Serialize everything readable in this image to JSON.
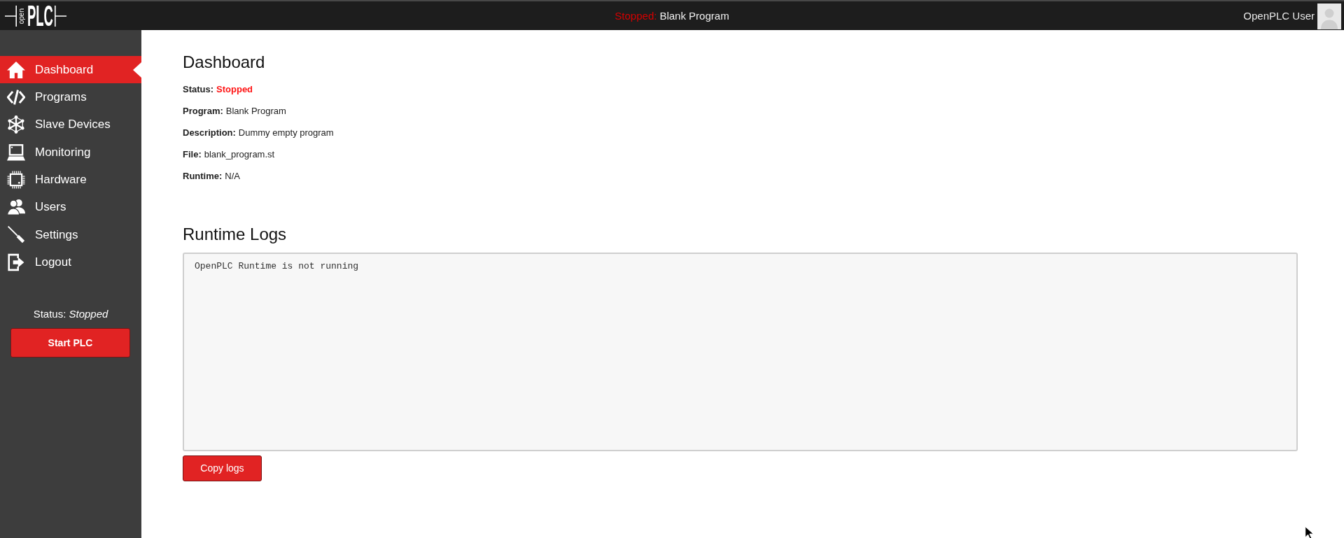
{
  "top_bar": {
    "logo": {
      "small_text": "open",
      "large_text": "PLC"
    },
    "run_state": "Stopped:",
    "program_name": "Blank Program",
    "user_name": "OpenPLC User"
  },
  "sidebar": {
    "items": [
      {
        "label": "Dashboard",
        "kind": "home",
        "selected": true
      },
      {
        "label": "Programs",
        "kind": "code",
        "selected": false
      },
      {
        "label": "Slave Devices",
        "kind": "nodes",
        "selected": false
      },
      {
        "label": "Monitoring",
        "kind": "laptop",
        "selected": false
      },
      {
        "label": "Hardware",
        "kind": "chip",
        "selected": false
      },
      {
        "label": "Users",
        "kind": "users",
        "selected": false
      },
      {
        "label": "Settings",
        "kind": "screwdriver",
        "selected": false
      },
      {
        "label": "Logout",
        "kind": "exit",
        "selected": false
      }
    ],
    "status": "Status: *Stopped*",
    "start_button": "Start PLC"
  },
  "dashboard": {
    "title": "Dashboard",
    "fields": [
      {
        "label": "Status:",
        "value": "Stopped",
        "kind": "status"
      },
      {
        "label": "Program:",
        "value": "Blank Program",
        "kind": "text"
      },
      {
        "label": "Description:",
        "value": "Dummy empty program",
        "kind": "text"
      },
      {
        "label": "File:",
        "value": "blank_program.st",
        "kind": "text"
      },
      {
        "label": "Runtime:",
        "value": "N/A",
        "kind": "text"
      }
    ]
  },
  "runtime_logs": {
    "title": "Runtime Logs",
    "log_text": "OpenPLC Runtime is not running",
    "copy_button": "Copy logs"
  }
}
